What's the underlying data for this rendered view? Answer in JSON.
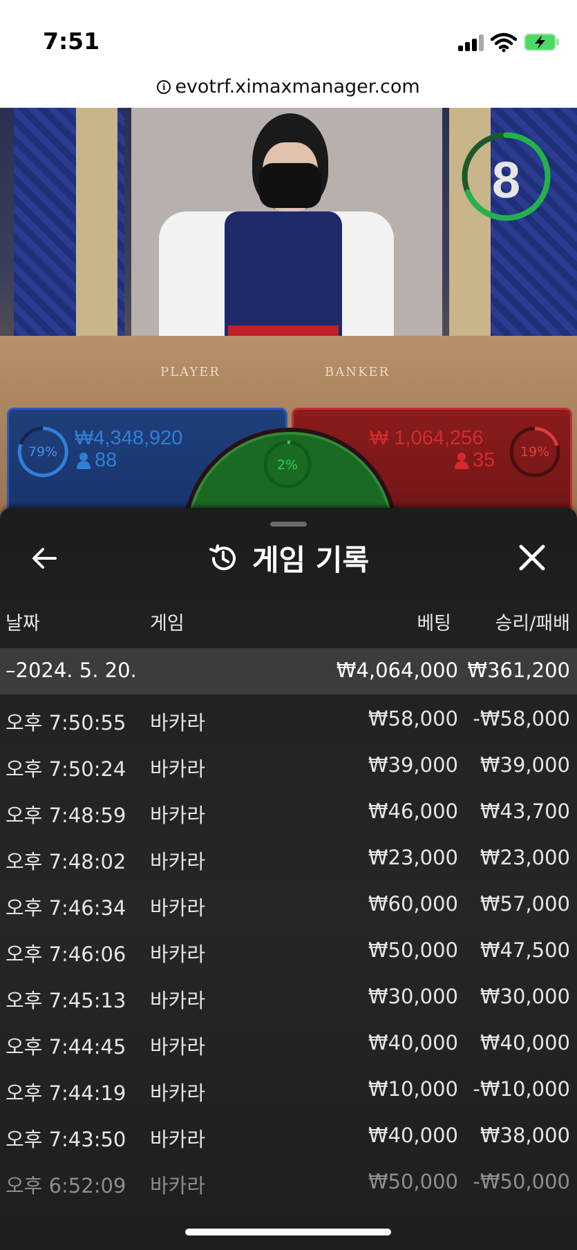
{
  "status_bar": {
    "time": "7:51"
  },
  "browser": {
    "url": "evotrf.ximaxmanager.com"
  },
  "live": {
    "countdown": "8",
    "felt_player": "PLAYER",
    "felt_banker": "BANKER",
    "player": {
      "percent": "79%",
      "amount": "₩4,348,920",
      "count": "88",
      "color": "#2f7fd8"
    },
    "banker": {
      "percent": "19%",
      "amount": "₩ 1,064,256",
      "count": "35",
      "color": "#d62a2a"
    },
    "tie": {
      "percent": "2%",
      "color": "#2fb53c"
    }
  },
  "history": {
    "title": "게임 기록",
    "columns": {
      "date": "날짜",
      "game": "게임",
      "bet": "베팅",
      "result": "승리/패배"
    },
    "date_group": {
      "label": "–2024. 5. 20.",
      "bet": "₩4,064,000",
      "result": "₩361,200"
    },
    "rows": [
      {
        "time": "오후 7:50:55",
        "game": "바카라",
        "bet": "₩58,000",
        "result": "-₩58,000"
      },
      {
        "time": "오후 7:50:24",
        "game": "바카라",
        "bet": "₩39,000",
        "result": "₩39,000"
      },
      {
        "time": "오후 7:48:59",
        "game": "바카라",
        "bet": "₩46,000",
        "result": "₩43,700"
      },
      {
        "time": "오후 7:48:02",
        "game": "바카라",
        "bet": "₩23,000",
        "result": "₩23,000"
      },
      {
        "time": "오후 7:46:34",
        "game": "바카라",
        "bet": "₩60,000",
        "result": "₩57,000"
      },
      {
        "time": "오후 7:46:06",
        "game": "바카라",
        "bet": "₩50,000",
        "result": "₩47,500"
      },
      {
        "time": "오후 7:45:13",
        "game": "바카라",
        "bet": "₩30,000",
        "result": "₩30,000"
      },
      {
        "time": "오후 7:44:45",
        "game": "바카라",
        "bet": "₩40,000",
        "result": "₩40,000"
      },
      {
        "time": "오후 7:44:19",
        "game": "바카라",
        "bet": "₩10,000",
        "result": "-₩10,000"
      },
      {
        "time": "오후 7:43:50",
        "game": "바카라",
        "bet": "₩40,000",
        "result": "₩38,000"
      },
      {
        "time": "오후 6:52:09",
        "game": "바카라",
        "bet": "₩50,000",
        "result": "-₩50,000"
      }
    ]
  }
}
